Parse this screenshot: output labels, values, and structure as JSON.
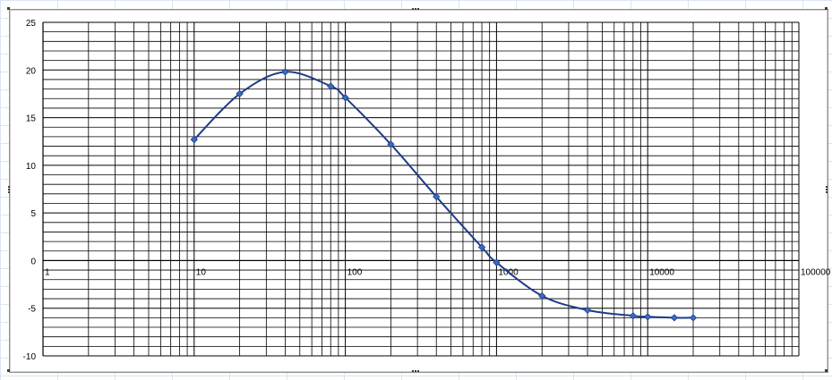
{
  "colors": {
    "series_line": "#1f3c88",
    "series_marker": "#3b6bc4",
    "grid": "#000000",
    "axis": "#000000"
  },
  "chart_data": {
    "type": "line",
    "title": "",
    "xlabel": "",
    "ylabel": "",
    "x_scale": "log",
    "xlim": [
      1,
      100000
    ],
    "ylim": [
      -10,
      25
    ],
    "y_major_step": 5,
    "y_minor_step": 1,
    "grid": true,
    "legend": "none",
    "x_tick_labels": [
      "1",
      "10",
      "100",
      "1000",
      "10000",
      "100000"
    ],
    "y_tick_labels": [
      "-10",
      "-5",
      "0",
      "5",
      "10",
      "15",
      "20",
      "25"
    ],
    "series": [
      {
        "x": [
          10,
          20,
          40,
          80,
          100,
          200,
          400,
          800,
          1000,
          2000,
          4000,
          8000,
          10000,
          15000,
          20000
        ],
        "y": [
          12.7,
          17.5,
          19.8,
          18.3,
          17.1,
          12.2,
          6.7,
          1.4,
          -0.2,
          -3.7,
          -5.2,
          -5.8,
          -5.9,
          -6.0,
          -6.0
        ]
      }
    ]
  }
}
